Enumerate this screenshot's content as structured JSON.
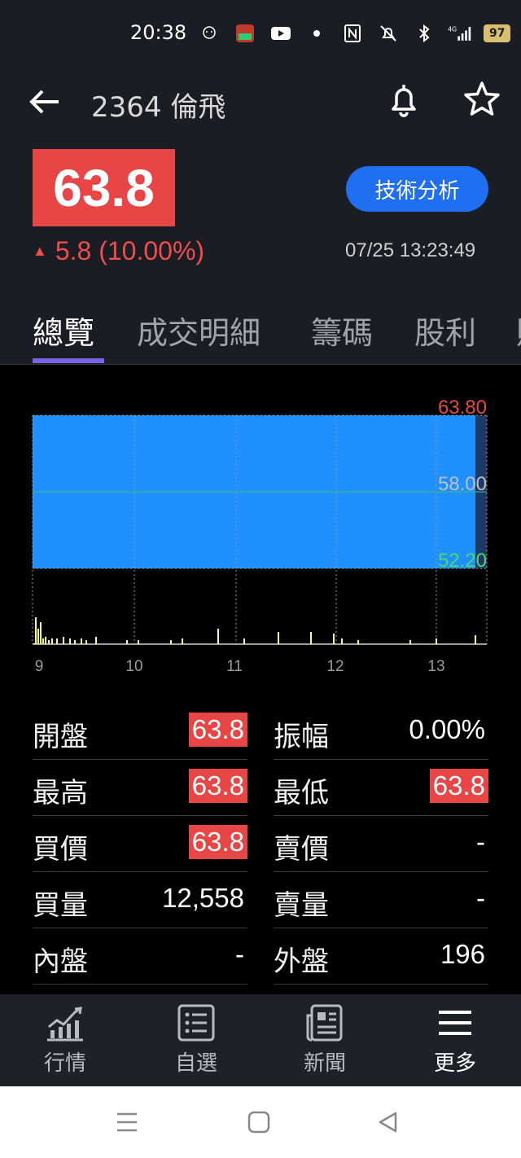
{
  "status_bar": {
    "time": "20:38",
    "icons": [
      "somaji-icon",
      "app-notification-icon",
      "youtube-icon",
      "dot-icon",
      "nfc-icon",
      "mute-icon",
      "bluetooth-icon",
      "signal-4g-icon"
    ],
    "battery": "97"
  },
  "app_bar": {
    "title": "2364 倫飛"
  },
  "quote": {
    "price": "63.8",
    "change": "5.8 (10.00%)",
    "timestamp": "07/25 13:23:49",
    "tech_button": "技術分析"
  },
  "tabs": [
    {
      "label": "總覽",
      "active": true
    },
    {
      "label": "成交明細",
      "active": false
    },
    {
      "label": "籌碼",
      "active": false
    },
    {
      "label": "股利",
      "active": false
    },
    {
      "label": "財",
      "active": false
    }
  ],
  "chart_data": {
    "type": "area",
    "y_labels": [
      "63.80",
      "58.00",
      "52.20"
    ],
    "y_label_colors": [
      "#e84646",
      "#bfbfbf",
      "#4cd964"
    ],
    "x_labels": [
      "9",
      "10",
      "11",
      "12",
      "13"
    ],
    "price_series": {
      "from_time": "9",
      "to_time": "13:23",
      "value": 63.8
    },
    "ylim": [
      52.2,
      63.8
    ],
    "area_color": "#1e90ff",
    "volume_color": "#ffff66"
  },
  "stats": {
    "left": [
      {
        "label": "開盤",
        "value": "63.8",
        "highlight": true
      },
      {
        "label": "最高",
        "value": "63.8",
        "highlight": true
      },
      {
        "label": "買價",
        "value": "63.8",
        "highlight": true
      },
      {
        "label": "買量",
        "value": "12,558",
        "highlight": false
      },
      {
        "label": "內盤",
        "value": "-",
        "highlight": false
      }
    ],
    "right": [
      {
        "label": "振幅",
        "value": "0.00%",
        "highlight": false
      },
      {
        "label": "最低",
        "value": "63.8",
        "highlight": true
      },
      {
        "label": "賣價",
        "value": "-",
        "highlight": false
      },
      {
        "label": "賣量",
        "value": "-",
        "highlight": false
      },
      {
        "label": "外盤",
        "value": "196",
        "highlight": false
      }
    ]
  },
  "bottom_nav": [
    {
      "label": "行情",
      "icon": "market-chart-icon",
      "active": false
    },
    {
      "label": "自選",
      "icon": "watchlist-icon",
      "active": false
    },
    {
      "label": "新聞",
      "icon": "news-icon",
      "active": false
    },
    {
      "label": "更多",
      "icon": "menu-icon",
      "active": true
    }
  ]
}
